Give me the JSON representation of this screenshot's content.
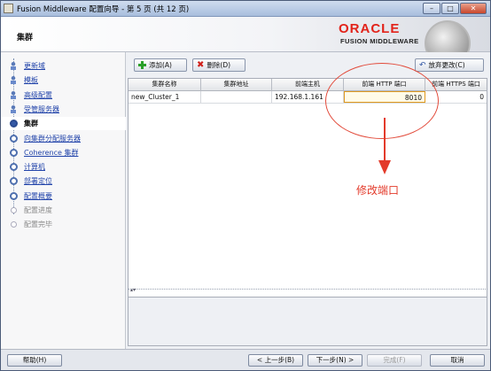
{
  "window": {
    "title": "Fusion Middleware 配置向导 - 第 5 页 (共 12 页)",
    "controls": [
      "minimize-icon",
      "maximize-icon",
      "close-icon"
    ]
  },
  "header": {
    "page_title": "集群",
    "logo_word": "ORACLE",
    "logo_sub": "FUSION MIDDLEWARE"
  },
  "steps": [
    {
      "label": "更新域",
      "state": "done",
      "icon": "person-icon"
    },
    {
      "label": "模板",
      "state": "done",
      "icon": "person-icon"
    },
    {
      "label": "高级配置",
      "state": "done",
      "icon": "person-icon"
    },
    {
      "label": "受管服务器",
      "state": "done",
      "icon": "person-icon"
    },
    {
      "label": "集群",
      "state": "current",
      "icon": "current-step-icon"
    },
    {
      "label": "向集群分配服务器",
      "state": "todo",
      "icon": "step-circle-icon"
    },
    {
      "label": "Coherence 集群",
      "state": "todo",
      "icon": "step-circle-icon"
    },
    {
      "label": "计算机",
      "state": "todo",
      "icon": "step-circle-icon"
    },
    {
      "label": "部署定位",
      "state": "todo",
      "icon": "step-circle-icon"
    },
    {
      "label": "配置概要",
      "state": "todo",
      "icon": "step-circle-icon"
    },
    {
      "label": "配置进度",
      "state": "disabled",
      "icon": "step-circle-icon"
    },
    {
      "label": "配置完毕",
      "state": "disabled",
      "icon": "step-circle-icon"
    }
  ],
  "toolbar": {
    "add_label": "添加(A)",
    "delete_label": "删除(D)",
    "revert_label": "放弃更改(C)"
  },
  "table": {
    "columns": [
      "集群名称",
      "集群地址",
      "前端主机",
      "前端 HTTP 端口",
      "前端 HTTPS 端口"
    ],
    "rows": [
      [
        "new_Cluster_1",
        "",
        "192.168.1.161",
        "8010",
        "0"
      ]
    ]
  },
  "annotation": {
    "text": "修改端口",
    "color": "#e33a2a"
  },
  "footer": {
    "help_label": "帮助(H)",
    "back_label": "< 上一步(B)",
    "next_label": "下一步(N) >",
    "finish_label": "完成(F)",
    "cancel_label": "取消"
  },
  "colors": {
    "oracle_red": "#e2231a",
    "link_blue": "#2244aa",
    "edit_border": "#e09a20"
  }
}
